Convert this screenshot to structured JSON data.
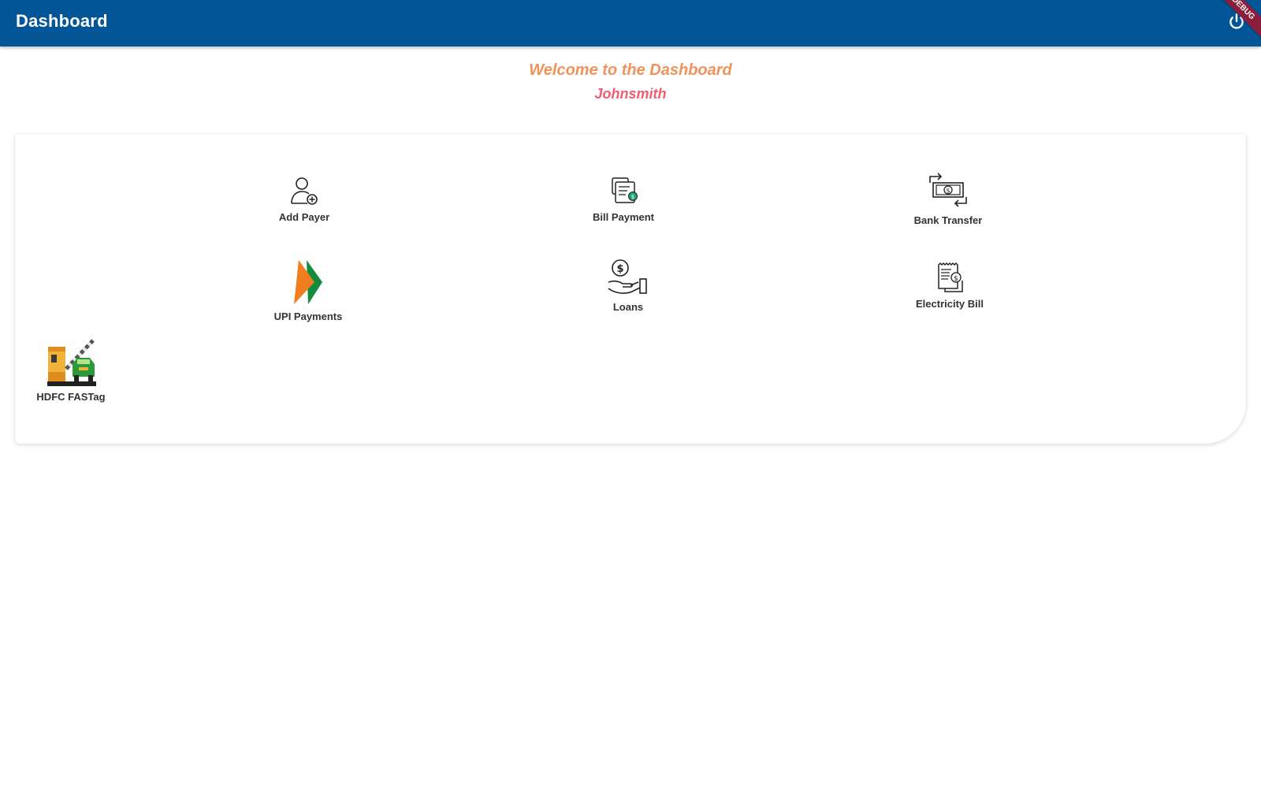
{
  "app_bar": {
    "title": "Dashboard",
    "logout_icon": "power-icon",
    "background_color": "#025596"
  },
  "debug_banner": {
    "label": "DEBUG",
    "color": "#8b1e3a"
  },
  "welcome": {
    "heading": "Welcome to the Dashboard",
    "username": "Johnsmith",
    "heading_color": "#f0935a",
    "username_color": "#ef5d6e"
  },
  "services": [
    {
      "label": "Add Payer",
      "icon": "add-user-icon"
    },
    {
      "label": "Bill Payment",
      "icon": "bill-payment-icon"
    },
    {
      "label": "Bank Transfer",
      "icon": "bank-transfer-icon"
    },
    {
      "label": "UPI Payments",
      "icon": "upi-logo-icon"
    },
    {
      "label": "Loans",
      "icon": "loan-hand-icon"
    },
    {
      "label": "Electricity Bill",
      "icon": "receipt-icon"
    },
    {
      "label": "HDFC FASTag",
      "icon": "toll-gate-icon"
    }
  ]
}
